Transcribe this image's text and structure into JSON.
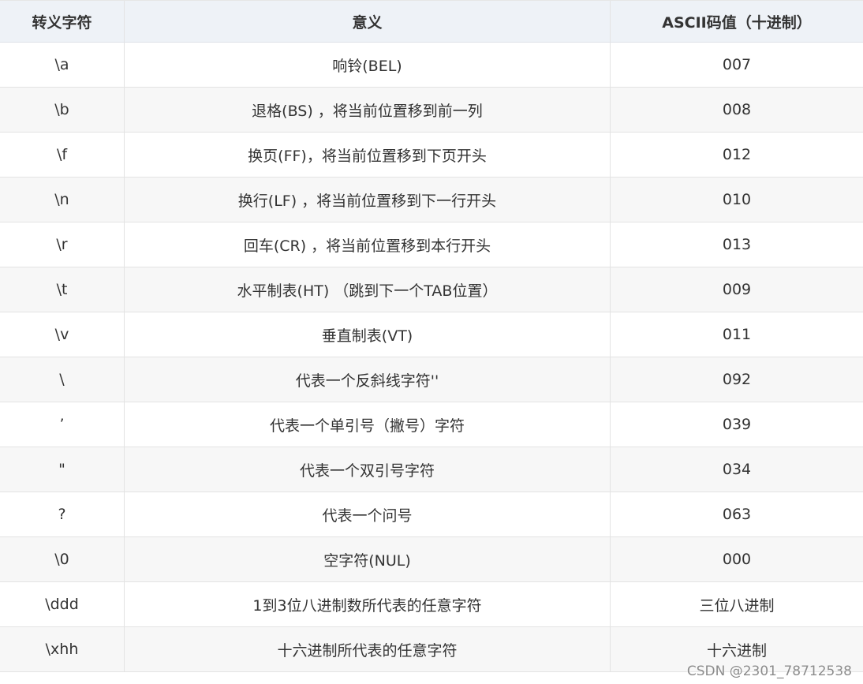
{
  "table": {
    "headers": [
      "转义字符",
      "意义",
      "ASCII码值（十进制）"
    ],
    "rows": [
      [
        "\\a",
        "响铃(BEL)",
        "007"
      ],
      [
        "\\b",
        "退格(BS) ，将当前位置移到前一列",
        "008"
      ],
      [
        "\\f",
        "换页(FF)，将当前位置移到下页开头",
        "012"
      ],
      [
        "\\n",
        "换行(LF) ，将当前位置移到下一行开头",
        "010"
      ],
      [
        "\\r",
        "回车(CR) ，将当前位置移到本行开头",
        "013"
      ],
      [
        "\\t",
        "水平制表(HT) （跳到下一个TAB位置）",
        "009"
      ],
      [
        "\\v",
        "垂直制表(VT)",
        "011"
      ],
      [
        "\\",
        "代表一个反斜线字符''",
        "092"
      ],
      [
        "’",
        "代表一个单引号（撇号）字符",
        "039"
      ],
      [
        "\"",
        "代表一个双引号字符",
        "034"
      ],
      [
        "?",
        "代表一个问号",
        "063"
      ],
      [
        "\\0",
        "空字符(NUL)",
        "000"
      ],
      [
        "\\ddd",
        "1到3位八进制数所代表的任意字符",
        "三位八进制"
      ],
      [
        "\\xhh",
        "十六进制所代表的任意字符",
        "十六进制"
      ]
    ]
  },
  "watermark": "CSDN @2301_78712538",
  "colors": {
    "header_bg": "#eef2f7",
    "alt_row_bg": "#f7f7f7",
    "border": "#e3e3e3",
    "text": "#333333"
  }
}
